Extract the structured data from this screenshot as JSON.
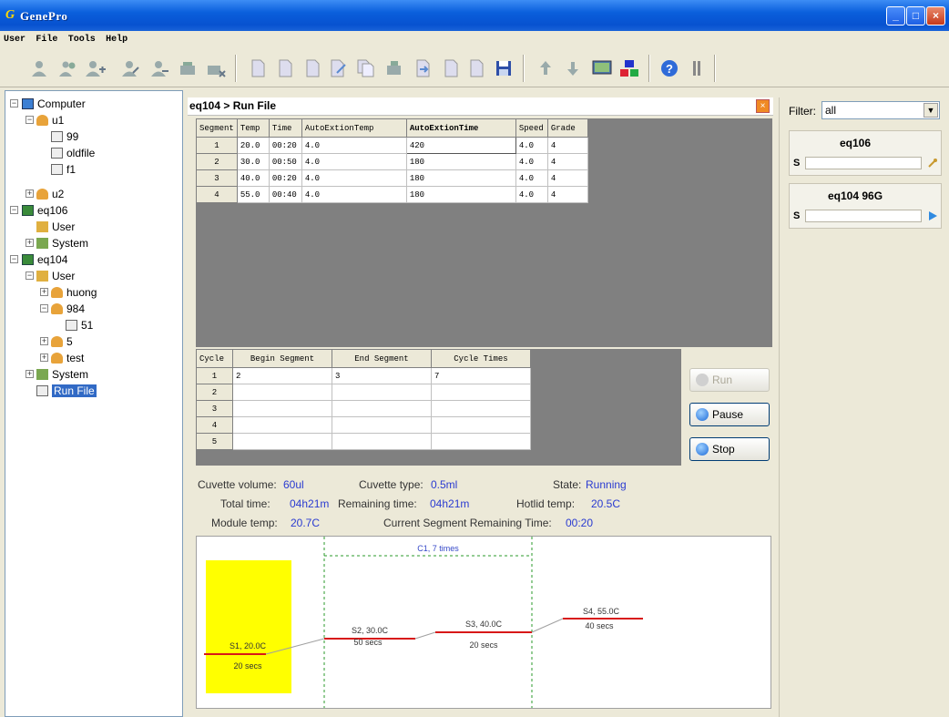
{
  "window": {
    "title": "GenePro"
  },
  "menu": [
    "User",
    "File",
    "Tools",
    "Help"
  ],
  "toolbar_icons": [
    "user-icon",
    "user-group-icon",
    "add-user-icon",
    "edit-user-icon",
    "remove-user-icon",
    "device-icon",
    "remove-device-icon",
    "new-file-icon",
    "open-file-icon",
    "blank-file-icon",
    "edit-file-icon",
    "copy-file-icon",
    "device-file-icon",
    "import-file-icon",
    "export-file-icon",
    "blank-file2-icon",
    "save-icon",
    "upload-icon",
    "download-icon",
    "monitor-icon",
    "network-icon",
    "help-icon",
    "info-icon"
  ],
  "tree": {
    "computer": "Computer",
    "u1": "u1",
    "f99": "99",
    "oldfile": "oldfile",
    "f1": "f1",
    "u2": "u2",
    "eq106": "eq106",
    "user106": "User",
    "system106": "System",
    "eq104": "eq104",
    "user104": "User",
    "huong": "huong",
    "g984": "984",
    "f51": "51",
    "g5": "5",
    "test": "test",
    "system104": "System",
    "runfile": "Run File"
  },
  "header": {
    "breadcrumb": "eq104 > Run File"
  },
  "segments": {
    "columns": [
      "Segment",
      "Temp",
      "Time",
      "AutoExtionTemp",
      "AutoExtionTime",
      "Speed",
      "Grade"
    ],
    "rows": [
      [
        "1",
        "20.0",
        "00:20",
        "4.0",
        "420",
        "4.0",
        "4"
      ],
      [
        "2",
        "30.0",
        "00:50",
        "4.0",
        "180",
        "4.0",
        "4"
      ],
      [
        "3",
        "40.0",
        "00:20",
        "4.0",
        "180",
        "4.0",
        "4"
      ],
      [
        "4",
        "55.0",
        "00:40",
        "4.0",
        "180",
        "4.0",
        "4"
      ]
    ]
  },
  "cycles": {
    "columns": [
      "Cycle",
      "Begin Segment",
      "End Segment",
      "Cycle Times"
    ],
    "rows": [
      [
        "1",
        "2",
        "3",
        "7"
      ],
      [
        "2",
        "",
        "",
        ""
      ],
      [
        "3",
        "",
        "",
        ""
      ],
      [
        "4",
        "",
        "",
        ""
      ],
      [
        "5",
        "",
        "",
        ""
      ]
    ]
  },
  "buttons": {
    "run": "Run",
    "pause": "Pause",
    "stop": "Stop"
  },
  "status": {
    "cuvette_volume_label": "Cuvette volume:",
    "cuvette_volume": "60ul",
    "cuvette_type_label": "Cuvette type:",
    "cuvette_type": "0.5ml",
    "state_label": "State:",
    "state": "Running",
    "total_time_label": "Total time:",
    "total_time": "04h21m",
    "remaining_time_label": "Remaining time:",
    "remaining_time": "04h21m",
    "hotlid_label": "Hotlid temp:",
    "hotlid": "20.5C",
    "module_temp_label": "Module temp:",
    "module_temp": "20.7C",
    "seg_remaining_label": "Current Segment Remaining Time:",
    "seg_remaining": "00:20"
  },
  "profile": {
    "cycle_label": "C1, 7 times",
    "segments": [
      {
        "label": "S1, 20.0C",
        "time": "20 secs"
      },
      {
        "label": "S2, 30.0C",
        "time": "50 secs"
      },
      {
        "label": "S3, 40.0C",
        "time": "20 secs"
      },
      {
        "label": "S4, 55.0C",
        "time": "40 secs"
      }
    ]
  },
  "filter": {
    "label": "Filter:",
    "value": "all"
  },
  "devices": [
    {
      "name": "eq106",
      "s": "S"
    },
    {
      "name": "eq104 96G",
      "s": "S"
    }
  ]
}
